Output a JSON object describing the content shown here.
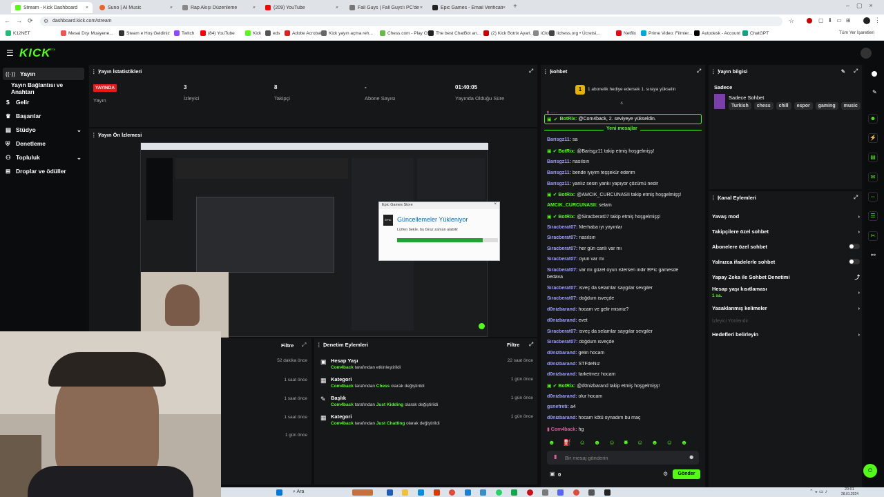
{
  "browser": {
    "tabs": [
      {
        "title": "Stream - Kick Dashboard",
        "active": true
      },
      {
        "title": "Suno | AI Music"
      },
      {
        "title": "Rap Akışı Düzenleme"
      },
      {
        "title": "(209) YouTube"
      },
      {
        "title": "Fall Guys | Fall Guys'ı PC'de Üc..."
      },
      {
        "title": "Epic Games - Email Verification"
      }
    ],
    "url": "dashboard.kick.com/stream",
    "bookmarks": [
      "K12NET",
      "Mesai Dışı Muayene...",
      "Steam e Hoş Geldiniz",
      "Twitch",
      "(84) YouTube",
      "Kick",
      "eds",
      "Adobe Acrobat",
      "Kick yayın açma reh...",
      "Chess.com - Play Ch...",
      "The best ChatBot an...",
      "(2) Kick Botrix Ayarl...",
      "iCloud",
      "lichess.org • Ücretsi...",
      "Netflix",
      "Prime Video: Filmler...",
      "Autodesk - Account",
      "ChatGPT"
    ],
    "all_bookmarks": "Tüm Yer İşaretleri"
  },
  "nav": {
    "logo": "KICK",
    "beta": "BETA"
  },
  "sidebar": {
    "items": [
      {
        "label": "Yayın"
      },
      {
        "label": "Yayın Bağlantısı ve Anahtarı"
      },
      {
        "label": "Gelir"
      },
      {
        "label": "Başarılar"
      },
      {
        "label": "Stüdyo"
      },
      {
        "label": "Denetleme"
      },
      {
        "label": "Topluluk"
      },
      {
        "label": "Droplar ve ödüller"
      }
    ]
  },
  "stats": {
    "title": "Yayın İstatistikleri",
    "live_badge": "YAYINDA",
    "cells": [
      {
        "value": "",
        "label": "Yayın"
      },
      {
        "value": "3",
        "label": "İzleyici"
      },
      {
        "value": "8",
        "label": "Takipçi"
      },
      {
        "value": "-",
        "label": "Abone Sayısı"
      },
      {
        "value": "01:40:05",
        "label": "Yayında Olduğu Süre"
      }
    ]
  },
  "preview": {
    "title": "Yayın Ön İzlemesi",
    "popup": {
      "window_title": "Epic Games Store",
      "heading": "Güncellemeler Yükleniyor",
      "subtext": "Lütfen bekle, bu biraz zaman alabilir",
      "progress": 0.85
    }
  },
  "activity": {
    "filter": "Filtre",
    "times": [
      "52 dakika önce",
      "1 saat önce",
      "1 saat önce",
      "1 saat önce",
      "1 gün önce"
    ]
  },
  "moderation": {
    "title": "Denetim Eylemleri",
    "filter": "Filtre",
    "items": [
      {
        "title": "Hesap Yaşı",
        "by": "Com4back",
        "mid": "tarafından",
        "value": "",
        "suffix": "etkinleştirildi",
        "time": "22 saat önce"
      },
      {
        "title": "Kategori",
        "by": "Com4back",
        "mid": "tarafından",
        "value": "Chess",
        "suffix": "olarak değiştirildi",
        "time": "1 gün önce"
      },
      {
        "title": "Başlık",
        "by": "Com4back",
        "mid": "tarafından",
        "value": "Just Kidding",
        "suffix": "olarak değiştirildi",
        "time": "1 gün önce"
      },
      {
        "title": "Kategori",
        "by": "Com4back",
        "mid": "tarafından",
        "value": "Just Chatting",
        "suffix": "olarak değiştirildi",
        "time": "1 gün önce"
      }
    ]
  },
  "chat": {
    "title": "Sohbet",
    "pinned": "1 abonelik hediye edersek 1. sıraya yükselin",
    "highlight": {
      "user": "BotRix:",
      "text": "@Com4back, 2. seviyeye yükseldin."
    },
    "new_messages": "Yeni mesajlar",
    "messages": [
      {
        "user": "Barisgz11:",
        "text": "sa",
        "color": "p"
      },
      {
        "user": "BotRix:",
        "text": "@Barisgz11 takip etmiş hoşgelmişş!",
        "color": "bot"
      },
      {
        "user": "Barisgz11:",
        "text": "nasılsın",
        "color": "p"
      },
      {
        "user": "Barisgz11:",
        "text": "bende iyiyim teşşekür ederim",
        "color": "p"
      },
      {
        "user": "Barisgz11:",
        "text": "yanlız sesin yankı yapıyor çözümü nedir",
        "color": "p"
      },
      {
        "user": "BotRix:",
        "text": "@AMCIK_CURCUNASII takip etmiş hoşgelmişş!",
        "color": "bot"
      },
      {
        "user": "AMCIK_CURCUNASII:",
        "text": "selam",
        "color": "g"
      },
      {
        "user": "BotRix:",
        "text": "@Siracberat07 takip etmiş hoşgelmişş!",
        "color": "bot"
      },
      {
        "user": "Siracberat07:",
        "text": "Merhaba iyi yayınlar",
        "color": "p"
      },
      {
        "user": "Siracberat07:",
        "text": "nasılsın",
        "color": "p"
      },
      {
        "user": "Siracberat07:",
        "text": "her gün canlı var mı",
        "color": "p"
      },
      {
        "user": "Siracberat07:",
        "text": "oyun var mı",
        "color": "p"
      },
      {
        "user": "Siracberat07:",
        "text": "var mı güzel oyun istersen indir EPic gamesde",
        "color": "p"
      },
      {
        "user": "",
        "text": "bedava",
        "color": "p"
      },
      {
        "user": "Siracberat07:",
        "text": "isveç da selamlar saygılar sevgiler",
        "color": "p"
      },
      {
        "user": "Siracberat07:",
        "text": "doğdum isveçde",
        "color": "p"
      },
      {
        "user": "d0nizbarand:",
        "text": "hocam ve gelir misiniz?",
        "color": "p"
      },
      {
        "user": "d0nizbarand:",
        "text": "evet",
        "color": "p"
      },
      {
        "user": "Siracberat07:",
        "text": "isveç da selamlar saygılar sevgiler",
        "color": "p"
      },
      {
        "user": "Siracberat07:",
        "text": "doğdum isveçde",
        "color": "p"
      },
      {
        "user": "d0nizbarand:",
        "text": "gelin hocam",
        "color": "p"
      },
      {
        "user": "d0nizbarand:",
        "text": "STFdeNiz",
        "color": "p"
      },
      {
        "user": "d0nizbarand:",
        "text": "farketmez hocam",
        "color": "p"
      },
      {
        "user": "BotRix:",
        "text": "@d0nizbarand takip etmiş hoşgelmişş!",
        "color": "bot"
      },
      {
        "user": "d0nizbarand:",
        "text": "olur hocam",
        "color": "p"
      },
      {
        "user": "gsnefreti:",
        "text": "a4",
        "color": "p"
      },
      {
        "user": "d0nizbarand:",
        "text": "hocam kötü oynadım bu maç",
        "color": "p"
      },
      {
        "user": "Com4back:",
        "text": "hg",
        "color": "pink"
      }
    ],
    "input_placeholder": "Bir mesaj gönderin",
    "count": "0",
    "send": "Gönder"
  },
  "stream_info": {
    "title": "Yayın bilgisi",
    "mode": "Sadece",
    "sub": "Sadece Sohbet",
    "tags": [
      "Turkish",
      "chess",
      "chill",
      "espor",
      "gaming",
      "music"
    ]
  },
  "channel_actions": {
    "title": "Kanal Eylemleri",
    "items": [
      {
        "label": "Yavaş mod",
        "control": "chevron"
      },
      {
        "label": "Takipçilere özel sohbet",
        "control": "chevron"
      },
      {
        "label": "Abonelere özel sohbet",
        "control": "toggle"
      },
      {
        "label": "Yalnızca ifadelerle sohbet",
        "control": "toggle"
      },
      {
        "label": "Yapay Zeka ile Sohbet Denetimi",
        "control": "link"
      },
      {
        "label": "Hesap yaşı kısıtlaması",
        "sub": "1 sa.",
        "control": "chevron"
      },
      {
        "label": "Yasaklanmış kelimeler",
        "control": "chevron"
      },
      {
        "label": "İzleyici Yönlendir",
        "control": "none",
        "disabled": true
      },
      {
        "label": "Hedefleri belirleyin",
        "control": "chevron"
      }
    ]
  },
  "taskbar": {
    "search": "Ara",
    "time": "20:01",
    "date": "28.01.2024"
  },
  "colors": {
    "accent": "#53fc18",
    "bg": "#0e0e10",
    "panel": "#161718",
    "live": "#e91916"
  }
}
